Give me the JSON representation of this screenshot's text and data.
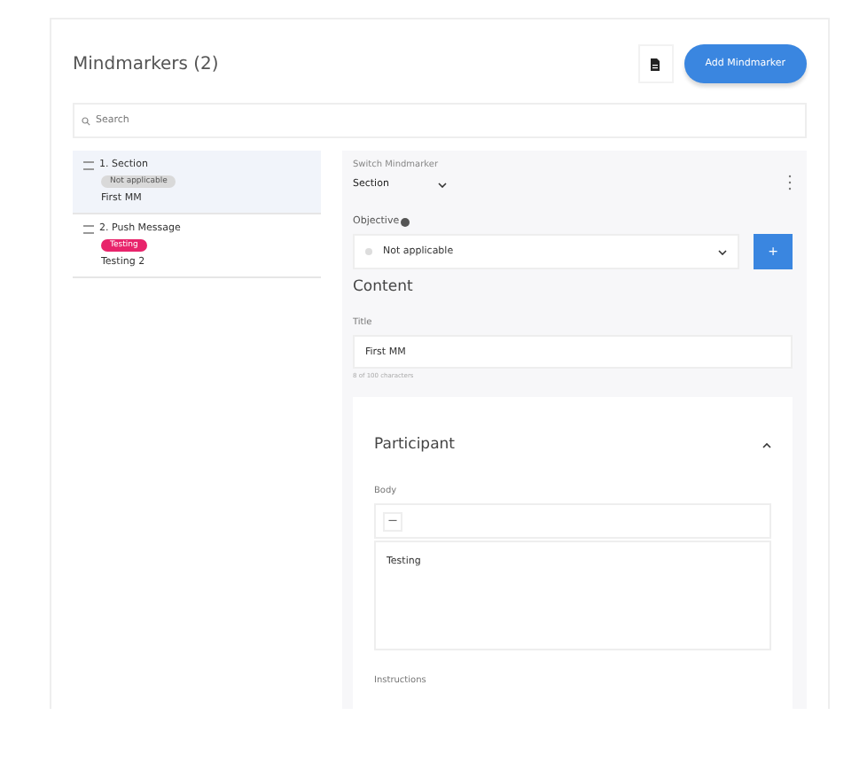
{
  "header": {
    "title": "Mindmarkers (2)",
    "add_button": "Add Mindmarker"
  },
  "search": {
    "placeholder": "Search"
  },
  "mindmarkers": [
    {
      "number": "1.",
      "name": "Section",
      "badge": "Not applicable",
      "color": "#d9d9d9",
      "subtitle": "First MM",
      "selected": true
    },
    {
      "number": "2.",
      "name": "Push Message",
      "badge": "Testing",
      "color": "#e8246b",
      "subtitle": "Testing 2",
      "selected": false
    }
  ],
  "editor": {
    "switch_label": "Switch Mindmarker",
    "switch_value": "Section",
    "objective_label": "Objective",
    "objective_value": "Not applicable",
    "add_objective": "+",
    "content_heading": "Content",
    "title_label": "Title",
    "title_value": "First MM",
    "title_hint": "8 of 100 characters",
    "participant": {
      "heading": "Participant",
      "expanded": true,
      "body_label": "Body",
      "toolbar_button": "—",
      "body_value": "Testing",
      "instructions_label": "Instructions"
    }
  }
}
